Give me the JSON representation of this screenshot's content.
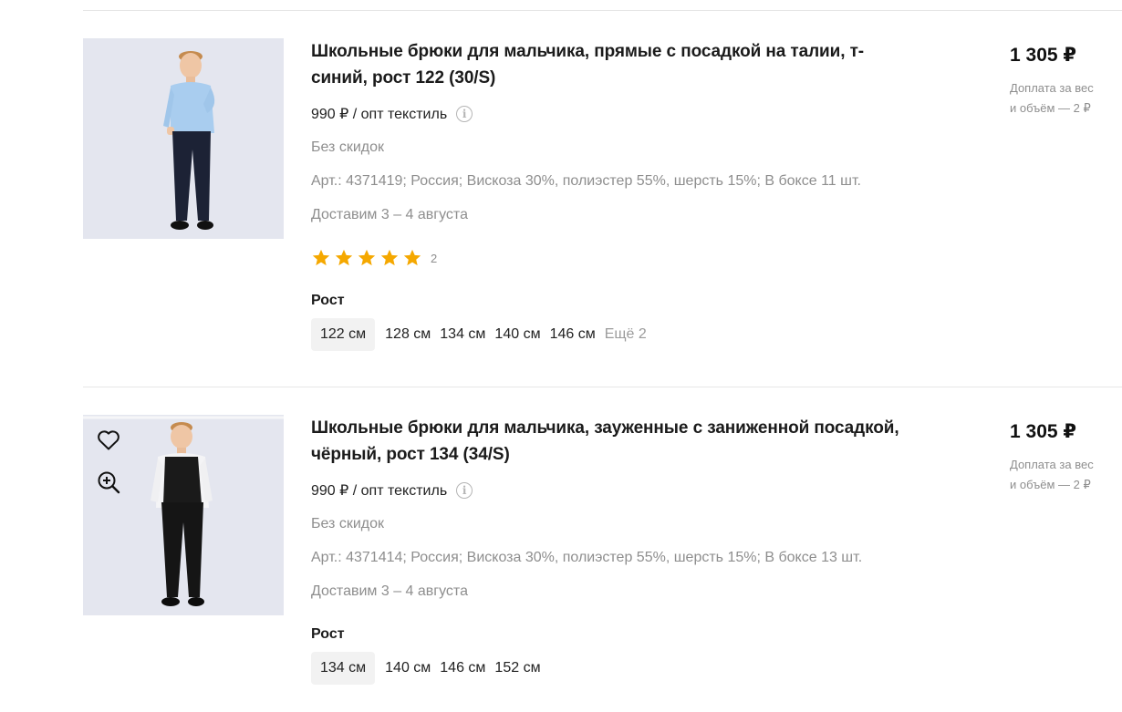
{
  "colors": {
    "star": "#f5a800",
    "muted": "#8e8e8e",
    "chip_bg": "#f2f2f2"
  },
  "products": [
    {
      "title": "Школьные брюки для мальчика, прямые с посадкой на талии, т-синий, рост 122 (30/S)",
      "opt_price": "990 ₽ / опт текстиль",
      "discount": "Без скидок",
      "details": "Арт.: 4371419; Россия;  Вискоза 30%, полиэстер 55%, шерсть 15%;  В боксе 11 шт.",
      "delivery": "Доставим 3 – 4 августа",
      "rating": 5,
      "reviews": "2",
      "size_label": "Рост",
      "sizes": [
        "122 см",
        "128 см",
        "134 см",
        "140 см",
        "146 см"
      ],
      "sizes_more": "Ещё 2",
      "selected_size": "122 см",
      "price": "1 305 ₽",
      "surcharge_line1": "Доплата за вес",
      "surcharge_line2": "и объём — 2 ₽",
      "shirt_color": "#a9cdef",
      "pants_color": "#1c2235"
    },
    {
      "title": "Школьные брюки для мальчика, зауженные с заниженной посадкой, чёрный, рост 134 (34/S)",
      "opt_price": "990 ₽ / опт текстиль",
      "discount": "Без скидок",
      "details": "Арт.: 4371414; Россия;  Вискоза 30%, полиэстер 55%, шерсть 15%;  В боксе 13 шт.",
      "delivery": "Доставим 3 – 4 августа",
      "size_label": "Рост",
      "sizes": [
        "134 см",
        "140 см",
        "146 см",
        "152 см"
      ],
      "selected_size": "134 см",
      "price": "1 305 ₽",
      "surcharge_line1": "Доплата за вес",
      "surcharge_line2": "и объём — 2 ₽",
      "shirt_color": "#f4f4f6",
      "pants_color": "#151515",
      "icons": [
        "heart-icon",
        "zoom-in-icon"
      ]
    }
  ]
}
